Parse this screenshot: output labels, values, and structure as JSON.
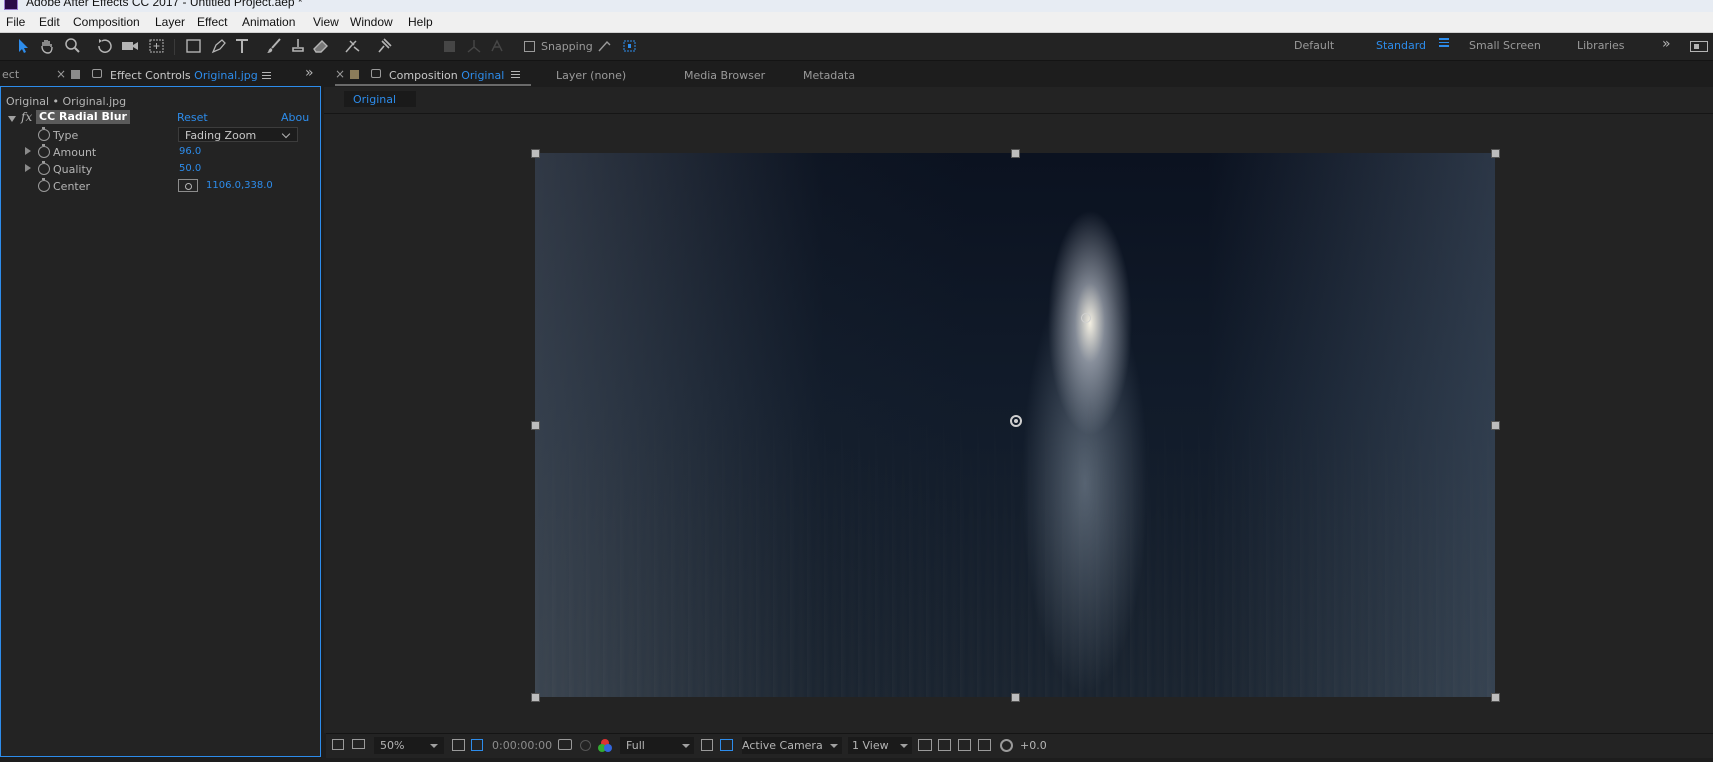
{
  "window": {
    "title": "Adobe After Effects CC 2017 - Untitled Project.aep *"
  },
  "menu": [
    "File",
    "Edit",
    "Composition",
    "Layer",
    "Effect",
    "Animation",
    "View",
    "Window",
    "Help"
  ],
  "toolbar": {
    "snapping_label": "Snapping",
    "workspaces": [
      "Default",
      "Standard",
      "Small Screen",
      "Libraries"
    ],
    "active_workspace": "Standard",
    "expand_icon": "»"
  },
  "effect_panel": {
    "prev_tab": "ect",
    "tab_prefix": "Effect Controls ",
    "tab_file": "Original.jpg",
    "layer_path": "Original • Original.jpg",
    "effect": {
      "fx_icon": "fx",
      "name": "CC Radial Blur",
      "reset": "Reset",
      "about": "Abou",
      "properties": [
        {
          "label": "Type",
          "value": "Fading Zoom"
        },
        {
          "label": "Amount",
          "value": "96.0"
        },
        {
          "label": "Quality",
          "value": "50.0"
        },
        {
          "label": "Center",
          "value": "1106.0,338.0"
        }
      ]
    }
  },
  "comp_panel": {
    "tab_prefix": "Composition ",
    "tab_name": "Original",
    "other_tabs": [
      "Layer (none)",
      "Media Browser",
      "Metadata"
    ],
    "breadcrumb": "Original"
  },
  "viewer_bar": {
    "zoom": "50%",
    "timecode": "0:00:00:00",
    "resolution": "Full",
    "camera": "Active Camera",
    "views": "1 View",
    "exposure": "+0.0"
  },
  "colors": {
    "accent": "#2d8ceb",
    "panel": "#232323",
    "background": "#1d1d1d"
  }
}
